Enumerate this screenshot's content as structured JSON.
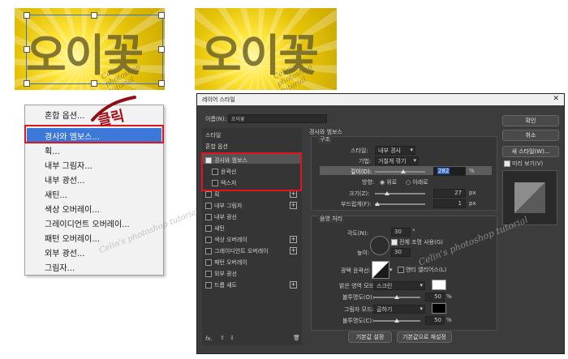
{
  "thumbnails": {
    "text": "오이꽃",
    "watermark": "Celin's photoshop tutorial"
  },
  "context_menu": {
    "items": [
      "혼합 옵션...",
      "경사와 엠보스...",
      "획...",
      "내부 그림자...",
      "내부 광선...",
      "새틴...",
      "색상 오버레이...",
      "그레이디언트 오버레이...",
      "패턴 오버레이...",
      "외부 광선...",
      "그림자..."
    ],
    "click_annotation": "클릭",
    "watermark": "Celin's photoshop tutorial"
  },
  "dialog": {
    "title": "레이어 스타일",
    "name_label": "이름(N):",
    "name_value": "오이꽃",
    "left_panel": {
      "styles_header": "스타일",
      "blend_options": "혼합 옵션",
      "items": [
        {
          "label": "경사와 엠보스",
          "checked": true,
          "plus": false
        },
        {
          "label": "윤곽선",
          "checked": false,
          "plus": false
        },
        {
          "label": "텍스처",
          "checked": false,
          "plus": false
        },
        {
          "label": "획",
          "checked": false,
          "plus": true
        },
        {
          "label": "내부 그림자",
          "checked": false,
          "plus": true
        },
        {
          "label": "내부 광선",
          "checked": false,
          "plus": false
        },
        {
          "label": "새틴",
          "checked": false,
          "plus": false
        },
        {
          "label": "색상 오버레이",
          "checked": false,
          "plus": true
        },
        {
          "label": "그레이디언트 오버레이",
          "checked": false,
          "plus": true
        },
        {
          "label": "패턴 오버레이",
          "checked": false,
          "plus": false
        },
        {
          "label": "외부 광선",
          "checked": false,
          "plus": false
        },
        {
          "label": "드롭 섀도",
          "checked": false,
          "plus": true
        }
      ],
      "footer_fx": "fx."
    },
    "bevel": {
      "section_title": "경사와 엠보스",
      "structure_title": "구조",
      "style_label": "스타일:",
      "style_value": "내부 경사",
      "technique_label": "기법:",
      "technique_value": "거칠게 깎기",
      "depth_label": "깊이(D):",
      "depth_value": "282",
      "depth_unit": "%",
      "direction_label": "방향:",
      "dir_up": "위로",
      "dir_down": "아래로",
      "size_label": "크기(Z):",
      "size_value": "27",
      "size_unit": "px",
      "soften_label": "부드럽게(F):",
      "soften_value": "1",
      "soften_unit": "px",
      "shading_title": "음영 처리",
      "angle_label": "각도(N):",
      "angle_value": "30",
      "angle_unit": "°",
      "global_light": "전체 조명 사용(G)",
      "altitude_label": "높이:",
      "altitude_value": "30",
      "gloss_label": "광택 윤곽선:",
      "anti_alias": "앤티 앨리어스(L)",
      "highlight_label": "밝은 영역 모드:",
      "highlight_mode": "스크린",
      "highlight_color": "#ffffff",
      "opacity1_label": "불투명도(O):",
      "opacity1_value": "50",
      "shadow_label": "그림자 모드:",
      "shadow_mode": "곱하기",
      "shadow_color": "#000000",
      "opacity2_label": "불투명도(C):",
      "opacity2_value": "50",
      "pct": "%",
      "btn_default": "기본값 설정",
      "btn_reset": "기본값으로 재설정"
    },
    "right": {
      "ok": "확인",
      "cancel": "취소",
      "new_style": "새 스타일(W)...",
      "preview": "미리 보기(V)"
    },
    "watermark": "Celin's photoshop tutorial"
  }
}
